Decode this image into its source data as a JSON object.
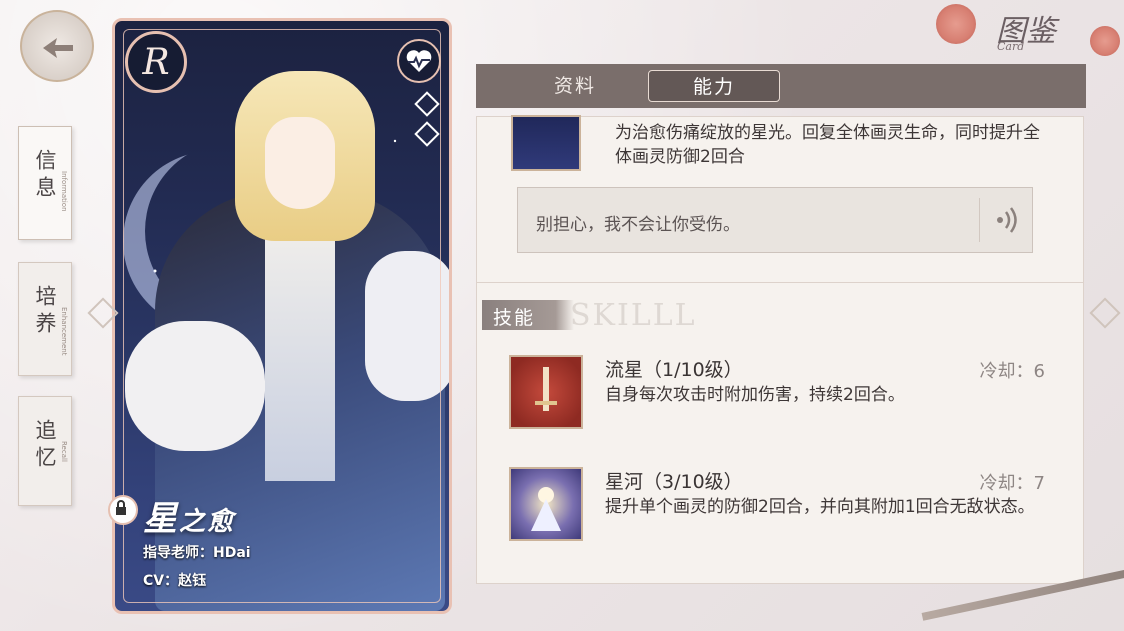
{
  "header": {
    "title_zh": "图鉴",
    "title_en": "Card"
  },
  "sidebar": {
    "tabs": [
      {
        "zh": "信息",
        "en": "Information"
      },
      {
        "zh": "培养",
        "en": "Enhancement"
      },
      {
        "zh": "追忆",
        "en": "Recall"
      }
    ]
  },
  "card": {
    "rarity": "R",
    "name_main": "星",
    "name_rest": "之愈",
    "mentor": "指导老师：HDai",
    "cv": "CV：赵钰"
  },
  "panel": {
    "tabs": [
      "资料",
      "能力"
    ],
    "active_tab": "能力",
    "top_desc": "为治愈伤痛绽放的星光。回复全体画灵生命，同时提升全体画灵防御2回合",
    "voice_line": "别担心，我不会让你受伤。",
    "skill_tag": "技能",
    "skill_watermark": "SKILLL",
    "skills": [
      {
        "name": "流星（1/10级）",
        "cooldown": "冷却：6",
        "desc": "自身每次攻击时附加伤害，持续2回合。"
      },
      {
        "name": "星河（3/10级）",
        "cooldown": "冷却：7",
        "desc": "提升单个画灵的防御2回合，并向其附加1回合无敌状态。"
      }
    ]
  },
  "icons": [
    "back-arrow-icon",
    "heart-monitor-icon",
    "lock-icon",
    "voice-play-icon",
    "diamond-icon"
  ],
  "colors": {
    "tab_bar": "#7a6e6b",
    "card_border": "#e9c1b3",
    "panel_bg": "#f6f2ee"
  }
}
